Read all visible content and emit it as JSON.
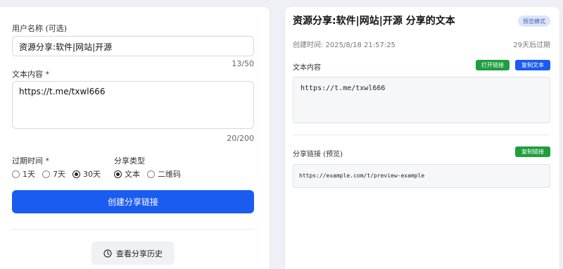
{
  "form": {
    "title_label": "用户名称 (可选)",
    "title_value": "资源分享:软件|网站|开源",
    "title_counter": "13/50",
    "content_label": "文本内容 *",
    "content_value": "https://t.me/txwl666",
    "content_counter": "20/200",
    "expire_label": "过期时间 *",
    "expire_options": [
      "1天",
      "7天",
      "30天"
    ],
    "expire_selected": "30天",
    "type_label": "分享类型",
    "type_options": [
      "文本",
      "二维码"
    ],
    "type_selected": "文本",
    "create_button": "创建分享链接",
    "history_button": "查看分享历史"
  },
  "preview": {
    "title": "资源分享:软件|网站|开源 分享的文本",
    "badge": "预览模式",
    "created": "创建时间:  2025/8/18 21:57:25",
    "expires": "29天后过期",
    "content_label": "文本内容",
    "open_link_button": "打开链接",
    "copy_text_button": "复制文本",
    "content_text": "https://t.me/txwl666",
    "link_label": "分享链接 (预览)",
    "copy_link_button": "复制链接",
    "link_text": "https://example.com/t/preview-example"
  },
  "colors": {
    "primary": "#1a5cf0",
    "success": "#1e9e3e",
    "badge_bg": "#dde5f7"
  },
  "icons": {
    "history": "clock-icon"
  }
}
